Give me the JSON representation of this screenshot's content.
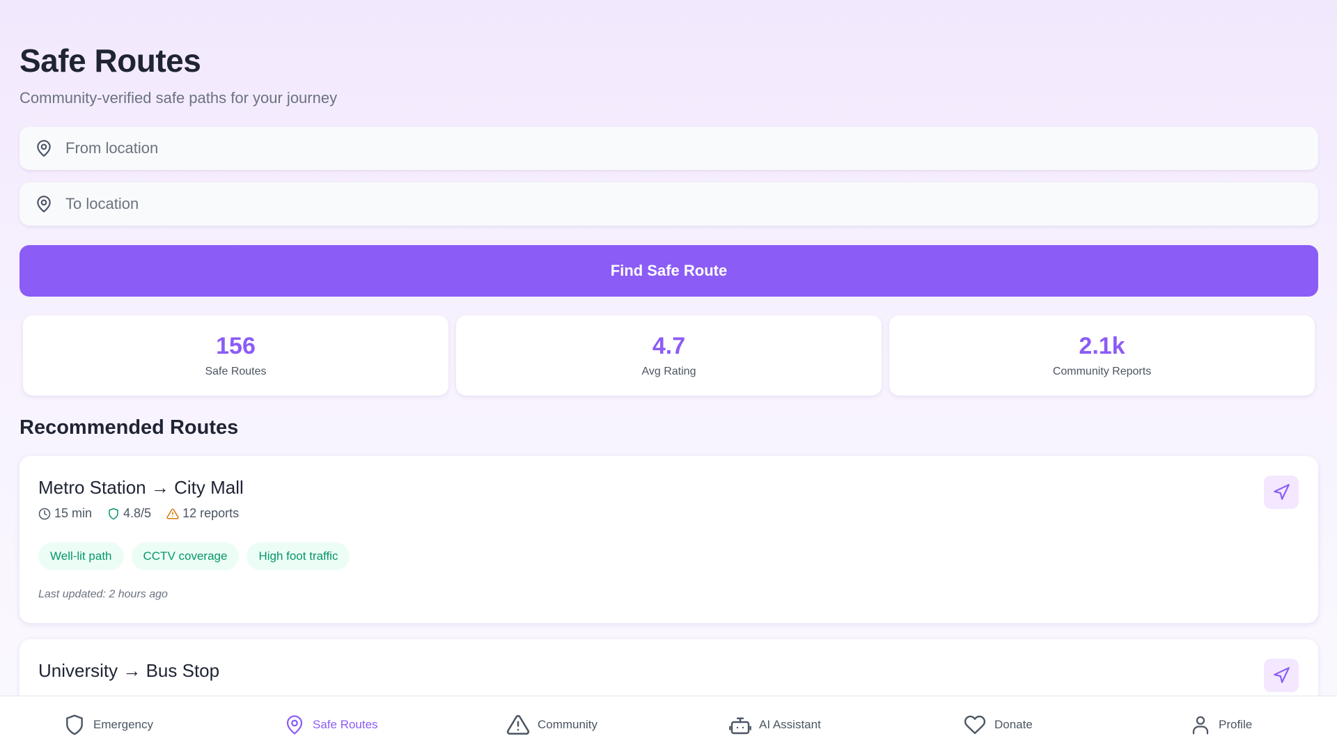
{
  "header": {
    "title": "Safe Routes",
    "subtitle": "Community-verified safe paths for your journey"
  },
  "search": {
    "from_placeholder": "From location",
    "to_placeholder": "To location",
    "find_button": "Find Safe Route"
  },
  "stats": [
    {
      "value": "156",
      "label": "Safe Routes"
    },
    {
      "value": "4.7",
      "label": "Avg Rating"
    },
    {
      "value": "2.1k",
      "label": "Community Reports"
    }
  ],
  "section_title": "Recommended Routes",
  "routes": [
    {
      "name": "Metro Station → City Mall",
      "time": "15 min",
      "rating": "4.8/5",
      "reports": "12 reports",
      "tags": [
        "Well-lit path",
        "CCTV coverage",
        "High foot traffic"
      ],
      "updated": "Last updated: 2 hours ago"
    },
    {
      "name": "University → Bus Stop"
    }
  ],
  "bottom_nav": [
    {
      "label": "Emergency",
      "icon": "shield-icon"
    },
    {
      "label": "Safe Routes",
      "icon": "map-pin-icon",
      "active": true
    },
    {
      "label": "Community",
      "icon": "alert-triangle-icon"
    },
    {
      "label": "AI Assistant",
      "icon": "bot-icon"
    },
    {
      "label": "Donate",
      "icon": "heart-icon"
    },
    {
      "label": "Profile",
      "icon": "user-icon"
    }
  ],
  "colors": {
    "accent": "#8b5cf6",
    "success": "#059669",
    "warning": "#d97706"
  }
}
